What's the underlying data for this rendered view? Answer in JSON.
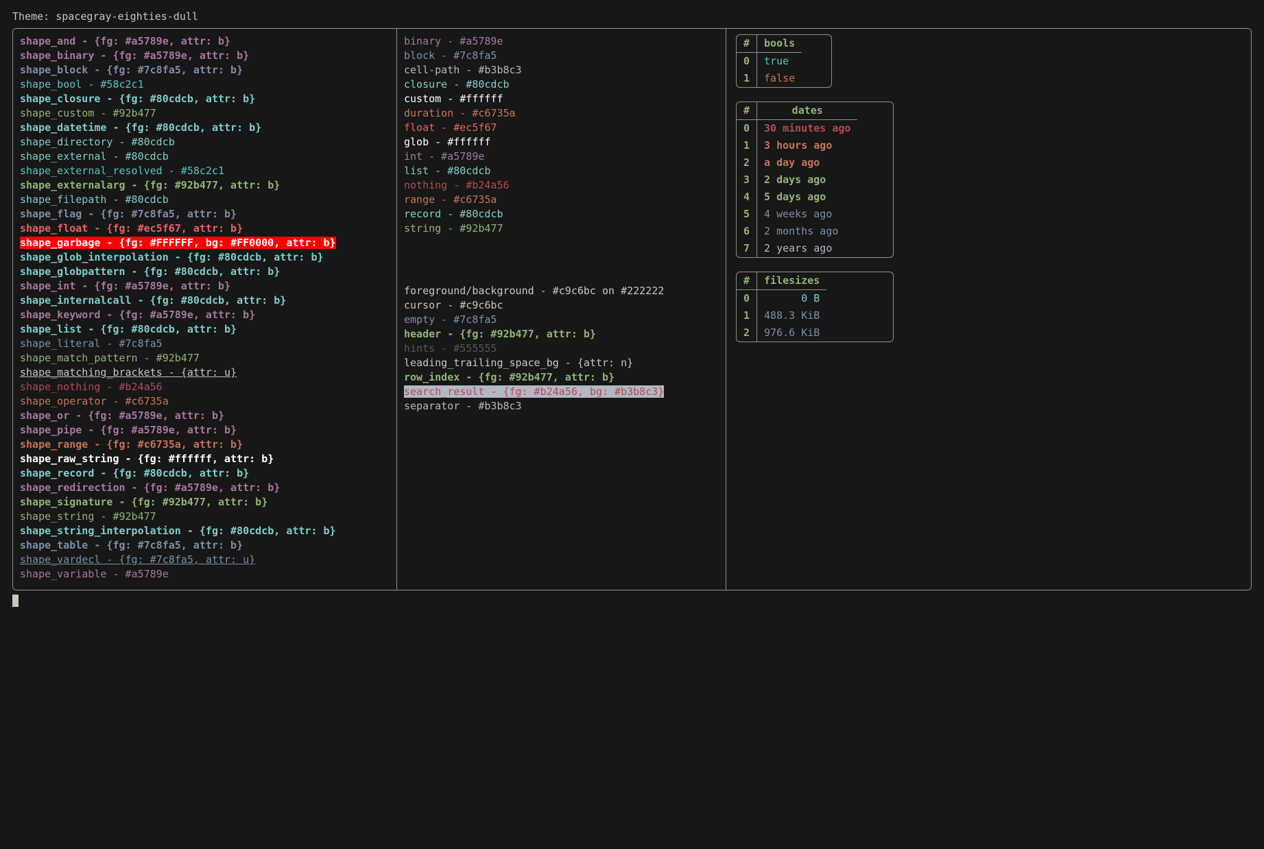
{
  "title_prefix": "Theme: ",
  "theme_name": "spacegray-eighties-dull",
  "sep": " - ",
  "colors": {
    "purple": "#a5789e",
    "blue": "#7c8fa5",
    "teal": "#58c2c1",
    "cyan": "#80cdcb",
    "green": "#92b477",
    "red": "#ec5f67",
    "maroon": "#b24a56",
    "orange": "#c6735a",
    "white": "#ffffff",
    "grey": "#b3b8c3",
    "dim": "#555555",
    "header": "#92b477",
    "idx": "#92b477"
  },
  "shapes": [
    {
      "k": "shape_and",
      "v": "{fg: #a5789e, attr: b}",
      "c": "purple",
      "b": true
    },
    {
      "k": "shape_binary",
      "v": "{fg: #a5789e, attr: b}",
      "c": "purple",
      "b": true
    },
    {
      "k": "shape_block",
      "v": "{fg: #7c8fa5, attr: b}",
      "c": "blue",
      "b": true
    },
    {
      "k": "shape_bool",
      "v": "#58c2c1",
      "c": "teal"
    },
    {
      "k": "shape_closure",
      "v": "{fg: #80cdcb, attr: b}",
      "c": "cyan",
      "b": true
    },
    {
      "k": "shape_custom",
      "v": "#92b477",
      "c": "green"
    },
    {
      "k": "shape_datetime",
      "v": "{fg: #80cdcb, attr: b}",
      "c": "cyan",
      "b": true
    },
    {
      "k": "shape_directory",
      "v": "#80cdcb",
      "c": "cyan"
    },
    {
      "k": "shape_external",
      "v": "#80cdcb",
      "c": "cyan"
    },
    {
      "k": "shape_external_resolved",
      "v": "#58c2c1",
      "c": "teal"
    },
    {
      "k": "shape_externalarg",
      "v": "{fg: #92b477, attr: b}",
      "c": "green",
      "b": true
    },
    {
      "k": "shape_filepath",
      "v": "#80cdcb",
      "c": "cyan"
    },
    {
      "k": "shape_flag",
      "v": "{fg: #7c8fa5, attr: b}",
      "c": "blue",
      "b": true
    },
    {
      "k": "shape_float",
      "v": "{fg: #ec5f67, attr: b}",
      "c": "red",
      "b": true
    },
    {
      "k": "shape_garbage",
      "v": "{fg: #FFFFFF, bg: #FF0000, attr: b}",
      "c": "white",
      "b": true,
      "bg": "#FF0000"
    },
    {
      "k": "shape_glob_interpolation",
      "v": "{fg: #80cdcb, attr: b}",
      "c": "cyan",
      "b": true
    },
    {
      "k": "shape_globpattern",
      "v": "{fg: #80cdcb, attr: b}",
      "c": "cyan",
      "b": true
    },
    {
      "k": "shape_int",
      "v": "{fg: #a5789e, attr: b}",
      "c": "purple",
      "b": true
    },
    {
      "k": "shape_internalcall",
      "v": "{fg: #80cdcb, attr: b}",
      "c": "cyan",
      "b": true
    },
    {
      "k": "shape_keyword",
      "v": "{fg: #a5789e, attr: b}",
      "c": "purple",
      "b": true
    },
    {
      "k": "shape_list",
      "v": "{fg: #80cdcb, attr: b}",
      "c": "cyan",
      "b": true
    },
    {
      "k": "shape_literal",
      "v": "#7c8fa5",
      "c": "blue"
    },
    {
      "k": "shape_match_pattern",
      "v": "#92b477",
      "c": "green"
    },
    {
      "k": "shape_matching_brackets",
      "v": "{attr: u}",
      "c": "fg",
      "u": true
    },
    {
      "k": "shape_nothing",
      "v": "#b24a56",
      "c": "maroon"
    },
    {
      "k": "shape_operator",
      "v": "#c6735a",
      "c": "orange"
    },
    {
      "k": "shape_or",
      "v": "{fg: #a5789e, attr: b}",
      "c": "purple",
      "b": true
    },
    {
      "k": "shape_pipe",
      "v": "{fg: #a5789e, attr: b}",
      "c": "purple",
      "b": true
    },
    {
      "k": "shape_range",
      "v": "{fg: #c6735a, attr: b}",
      "c": "orange",
      "b": true
    },
    {
      "k": "shape_raw_string",
      "v": "{fg: #ffffff, attr: b}",
      "c": "white",
      "b": true
    },
    {
      "k": "shape_record",
      "v": "{fg: #80cdcb, attr: b}",
      "c": "cyan",
      "b": true
    },
    {
      "k": "shape_redirection",
      "v": "{fg: #a5789e, attr: b}",
      "c": "purple",
      "b": true
    },
    {
      "k": "shape_signature",
      "v": "{fg: #92b477, attr: b}",
      "c": "green",
      "b": true
    },
    {
      "k": "shape_string",
      "v": "#92b477",
      "c": "green"
    },
    {
      "k": "shape_string_interpolation",
      "v": "{fg: #80cdcb, attr: b}",
      "c": "cyan",
      "b": true
    },
    {
      "k": "shape_table",
      "v": "{fg: #7c8fa5, attr: b}",
      "c": "blue",
      "b": true
    },
    {
      "k": "shape_vardecl",
      "v": "{fg: #7c8fa5, attr: u}",
      "c": "blue",
      "u": true
    },
    {
      "k": "shape_variable",
      "v": "#a5789e",
      "c": "purple"
    }
  ],
  "types": [
    {
      "k": "binary",
      "v": "#a5789e",
      "c": "purple"
    },
    {
      "k": "block",
      "v": "#7c8fa5",
      "c": "blue"
    },
    {
      "k": "cell-path",
      "v": "#b3b8c3",
      "c": "grey"
    },
    {
      "k": "closure",
      "v": "#80cdcb",
      "c": "cyan"
    },
    {
      "k": "custom",
      "v": "#ffffff",
      "c": "white"
    },
    {
      "k": "duration",
      "v": "#c6735a",
      "c": "orange"
    },
    {
      "k": "float",
      "v": "#ec5f67",
      "c": "red"
    },
    {
      "k": "glob",
      "v": "#ffffff",
      "c": "white"
    },
    {
      "k": "int",
      "v": "#a5789e",
      "c": "purple"
    },
    {
      "k": "list",
      "v": "#80cdcb",
      "c": "cyan"
    },
    {
      "k": "nothing",
      "v": "#b24a56",
      "c": "maroon"
    },
    {
      "k": "range",
      "v": "#c6735a",
      "c": "orange"
    },
    {
      "k": "record",
      "v": "#80cdcb",
      "c": "cyan"
    },
    {
      "k": "string",
      "v": "#92b477",
      "c": "green"
    }
  ],
  "misc": [
    {
      "k": "foreground/background",
      "v": "#c9c6bc on #222222",
      "c": "fg"
    },
    {
      "k": "cursor",
      "v": "#c9c6bc",
      "c": "fg"
    },
    {
      "k": "empty",
      "v": "#7c8fa5",
      "c": "blue"
    },
    {
      "k": "header",
      "v": "{fg: #92b477, attr: b}",
      "c": "green",
      "b": true
    },
    {
      "k": "hints",
      "v": "#555555",
      "c": "dim"
    },
    {
      "k": "leading_trailing_space_bg",
      "v": "{attr: n}",
      "c": "fg"
    },
    {
      "k": "row_index",
      "v": "{fg: #92b477, attr: b}",
      "c": "green",
      "b": true
    },
    {
      "k": "search_result",
      "v": "{fg: #b24a56, bg: #b3b8c3}",
      "c": "maroon",
      "bg": "#b3b8c3"
    },
    {
      "k": "separator",
      "v": "#b3b8c3",
      "c": "grey"
    }
  ],
  "tables": {
    "bools": {
      "header": "bools",
      "rows": [
        {
          "i": "0",
          "v": "true",
          "c": "teal"
        },
        {
          "i": "1",
          "v": "false",
          "c": "orange"
        }
      ]
    },
    "dates": {
      "header": "dates",
      "rows": [
        {
          "i": "0",
          "v": "30 minutes ago",
          "c": "maroon",
          "b": true
        },
        {
          "i": "1",
          "v": "3 hours ago",
          "c": "orange",
          "b": true
        },
        {
          "i": "2",
          "v": "a day ago",
          "c": "orange",
          "b": true
        },
        {
          "i": "3",
          "v": "2 days ago",
          "c": "green",
          "b": true
        },
        {
          "i": "4",
          "v": "5 days ago",
          "c": "green",
          "b": true
        },
        {
          "i": "5",
          "v": "4 weeks ago",
          "c": "blue"
        },
        {
          "i": "6",
          "v": "2 months ago",
          "c": "blue"
        },
        {
          "i": "7",
          "v": "2 years ago",
          "c": "grey"
        }
      ]
    },
    "filesizes": {
      "header": "filesizes",
      "rows": [
        {
          "i": "0",
          "v": "0 B",
          "c": "cyan"
        },
        {
          "i": "1",
          "v": "488.3 KiB",
          "c": "blue"
        },
        {
          "i": "2",
          "v": "976.6 KiB",
          "c": "blue"
        }
      ],
      "align": "right"
    }
  }
}
